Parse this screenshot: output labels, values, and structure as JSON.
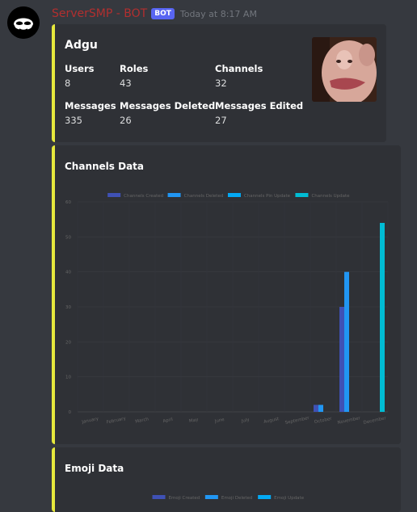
{
  "message": {
    "username": "ServerSMP - BOT",
    "bot_tag": "BOT",
    "timestamp": "Today at 8:17 AM",
    "username_color": "#b22f2f"
  },
  "embed_color": "#e6e83c",
  "stats_embed": {
    "title": "Adgu",
    "fields": [
      {
        "name": "Users",
        "value": "8"
      },
      {
        "name": "Roles",
        "value": "43"
      },
      {
        "name": "Channels",
        "value": "32"
      },
      {
        "name": "Messages",
        "value": "335"
      },
      {
        "name": "Messages Deleted",
        "value": "26"
      },
      {
        "name": "Messages Edited",
        "value": "27"
      }
    ]
  },
  "channels_embed": {
    "title": "Channels Data"
  },
  "emoji_embed": {
    "title": "Emoji Data"
  },
  "chart_data": [
    {
      "type": "bar",
      "title": "",
      "categories": [
        "January",
        "February",
        "March",
        "April",
        "May",
        "June",
        "July",
        "August",
        "September",
        "October",
        "November",
        "December"
      ],
      "ylim": [
        0,
        60
      ],
      "yticks": [
        "0",
        "10",
        "20",
        "30",
        "40",
        "50",
        "60"
      ],
      "grid": true,
      "legend_position": "top",
      "series": [
        {
          "name": "Channels Created",
          "color": "#3f51b5",
          "values": [
            0,
            0,
            0,
            0,
            0,
            0,
            0,
            0,
            0,
            2,
            30,
            0
          ]
        },
        {
          "name": "Channels Deleted",
          "color": "#2196f3",
          "values": [
            0,
            0,
            0,
            0,
            0,
            0,
            0,
            0,
            0,
            2,
            40,
            0
          ]
        },
        {
          "name": "Channels Pin Update",
          "color": "#03a9f4",
          "values": [
            0,
            0,
            0,
            0,
            0,
            0,
            0,
            0,
            0,
            0,
            0,
            0
          ]
        },
        {
          "name": "Channels Update",
          "color": "#00bcd4",
          "values": [
            0,
            0,
            0,
            0,
            0,
            0,
            0,
            0,
            0,
            0,
            0,
            54
          ]
        }
      ]
    },
    {
      "type": "bar",
      "title": "",
      "legend_position": "top",
      "series": [
        {
          "name": "Emoji Created",
          "color": "#3f51b5",
          "values": []
        },
        {
          "name": "Emoji Deleted",
          "color": "#2196f3",
          "values": []
        },
        {
          "name": "Emoji Update",
          "color": "#03a9f4",
          "values": []
        }
      ]
    }
  ]
}
